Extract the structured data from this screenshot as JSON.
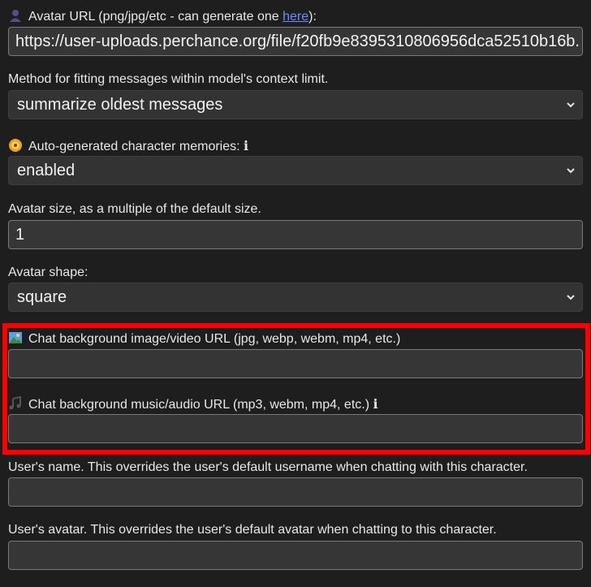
{
  "avatar_url": {
    "icon": "person-silhouette-icon",
    "label_prefix": "Avatar URL (png/jpg/etc - can generate one ",
    "link_text": "here",
    "label_suffix": "):",
    "value": "https://user-uploads.perchance.org/file/f20fb9e8395310806956dca52510b16b."
  },
  "fit_method": {
    "label": "Method for fitting messages within model's context limit.",
    "selected": "summarize oldest messages"
  },
  "memories": {
    "icon": "disc-icon",
    "label": "Auto-generated character memories: ",
    "info": "ℹ",
    "selected": "enabled"
  },
  "avatar_size": {
    "label": "Avatar size, as a multiple of the default size.",
    "value": "1"
  },
  "avatar_shape": {
    "label": "Avatar shape:",
    "selected": "square"
  },
  "bg_image": {
    "icon": "picture-icon",
    "label": "Chat background image/video URL (jpg, webp, webm, mp4, etc.)",
    "value": ""
  },
  "bg_music": {
    "icon": "music-note-icon",
    "label": "Chat background music/audio URL (mp3, webm, mp4, etc.) ",
    "info": "ℹ",
    "value": ""
  },
  "user_name": {
    "label": "User's name. This overrides the user's default username when chatting with this character.",
    "value": ""
  },
  "user_avatar": {
    "label": "User's avatar. This overrides the user's default avatar when chatting to this character.",
    "value": ""
  },
  "colors": {
    "highlight": "#ff0000",
    "link": "#6d8cff",
    "background": "#1e1e1e"
  }
}
